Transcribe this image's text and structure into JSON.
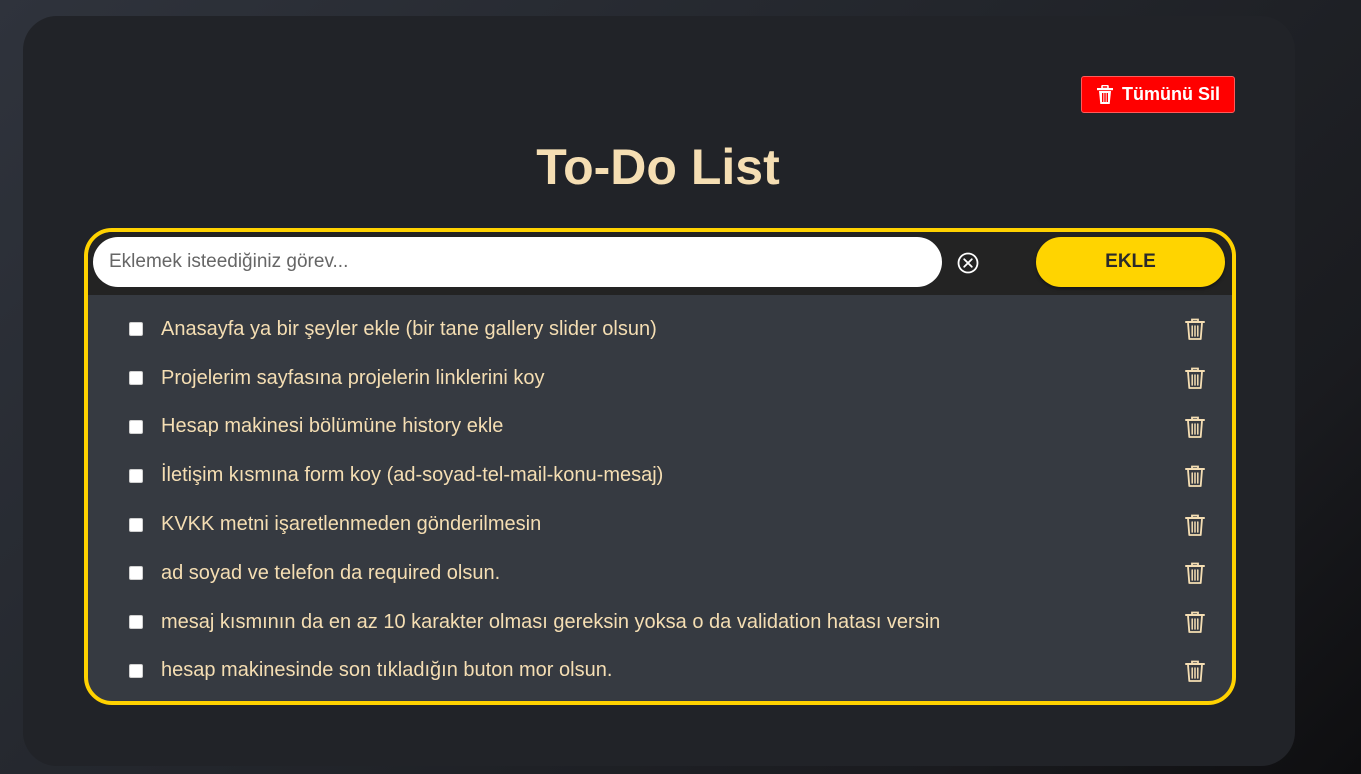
{
  "header": {
    "delete_all_label": "Tümünü Sil",
    "title": "To-Do List"
  },
  "input": {
    "placeholder": "Eklemek isteediğiniz görev...",
    "value": "",
    "add_label": "EKLE"
  },
  "todos": [
    {
      "text": "Anasayfa ya bir şeyler ekle (bir tane gallery slider olsun)",
      "checked": false
    },
    {
      "text": "Projelerim sayfasına projelerin linklerini koy",
      "checked": false
    },
    {
      "text": "Hesap makinesi bölümüne history ekle",
      "checked": false
    },
    {
      "text": "İletişim kısmına form koy (ad-soyad-tel-mail-konu-mesaj)",
      "checked": false
    },
    {
      "text": "KVKK metni işaretlenmeden gönderilmesin",
      "checked": false
    },
    {
      "text": "ad soyad ve telefon da required olsun.",
      "checked": false
    },
    {
      "text": "mesaj kısmının da en az 10 karakter olması gereksin yoksa o da validation hatası versin",
      "checked": false
    },
    {
      "text": "hesap makinesinde son tıkladığın buton mor olsun.",
      "checked": false
    }
  ],
  "colors": {
    "accent": "#ffd200",
    "danger": "#ff0000",
    "text": "#f5deb3"
  },
  "icons": {
    "delete_all": "trash-icon",
    "clear": "circle-x-icon",
    "item_delete": "trash-outline-icon"
  }
}
